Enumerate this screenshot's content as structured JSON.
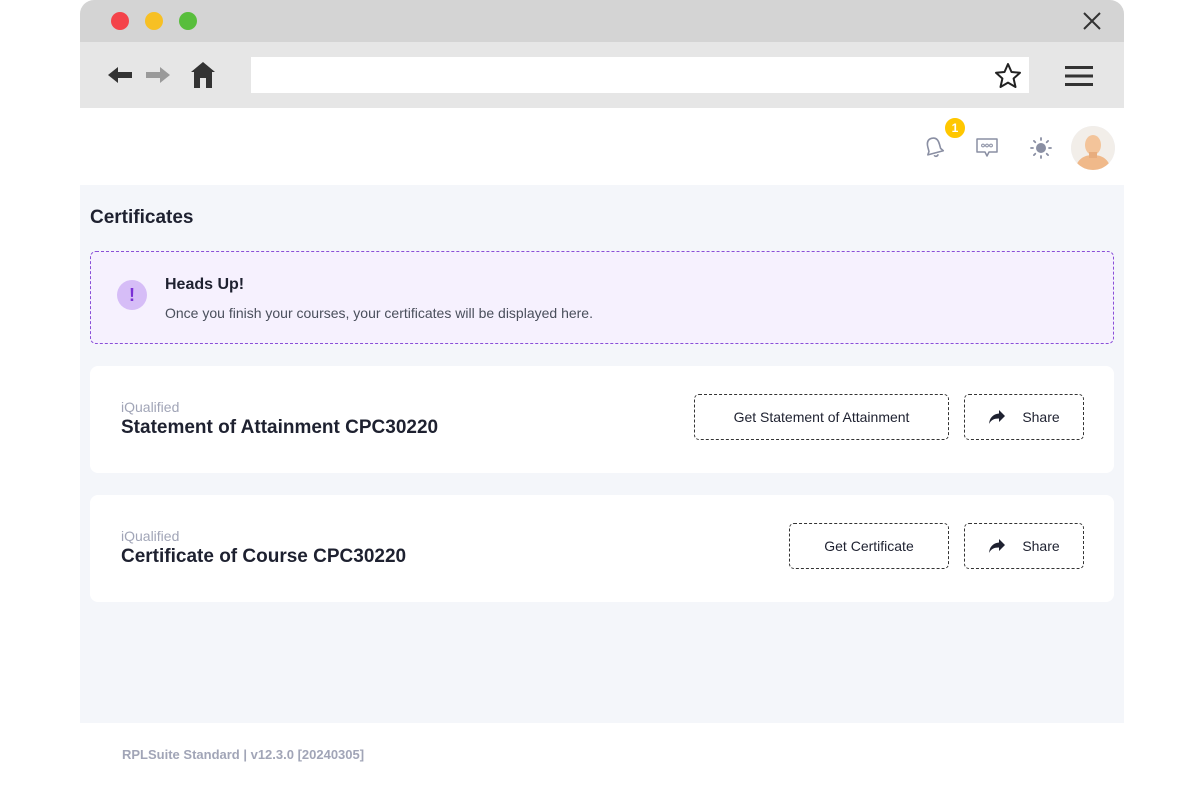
{
  "browser": {
    "url": "",
    "icons": [
      "close-icon",
      "back-arrow-icon",
      "forward-arrow-icon",
      "home-icon",
      "star-icon",
      "hamburger-menu-icon"
    ]
  },
  "header": {
    "notification_count": "1",
    "icons": [
      "bell-icon",
      "chat-icon",
      "sun-icon",
      "avatar"
    ]
  },
  "page": {
    "title": "Certificates"
  },
  "alert": {
    "icon_glyph": "!",
    "title": "Heads Up!",
    "message": "Once you finish your courses, your certificates will be displayed here.",
    "accent": "#8a4fd8"
  },
  "certificates": [
    {
      "org": "iQualified",
      "title": "Statement of Attainment CPC30220",
      "primary_button": "Get Statement of Attainment",
      "share_button": "Share"
    },
    {
      "org": "iQualified",
      "title": "Certificate of Course CPC30220",
      "primary_button": "Get Certificate",
      "share_button": "Share"
    }
  ],
  "footer": {
    "version_text": "RPLSuite Standard | v12.3.0 [20240305]"
  },
  "colors": {
    "content_bg": "#f4f6fa",
    "badge": "#ffc700",
    "muted_text": "#a1a5b7"
  }
}
